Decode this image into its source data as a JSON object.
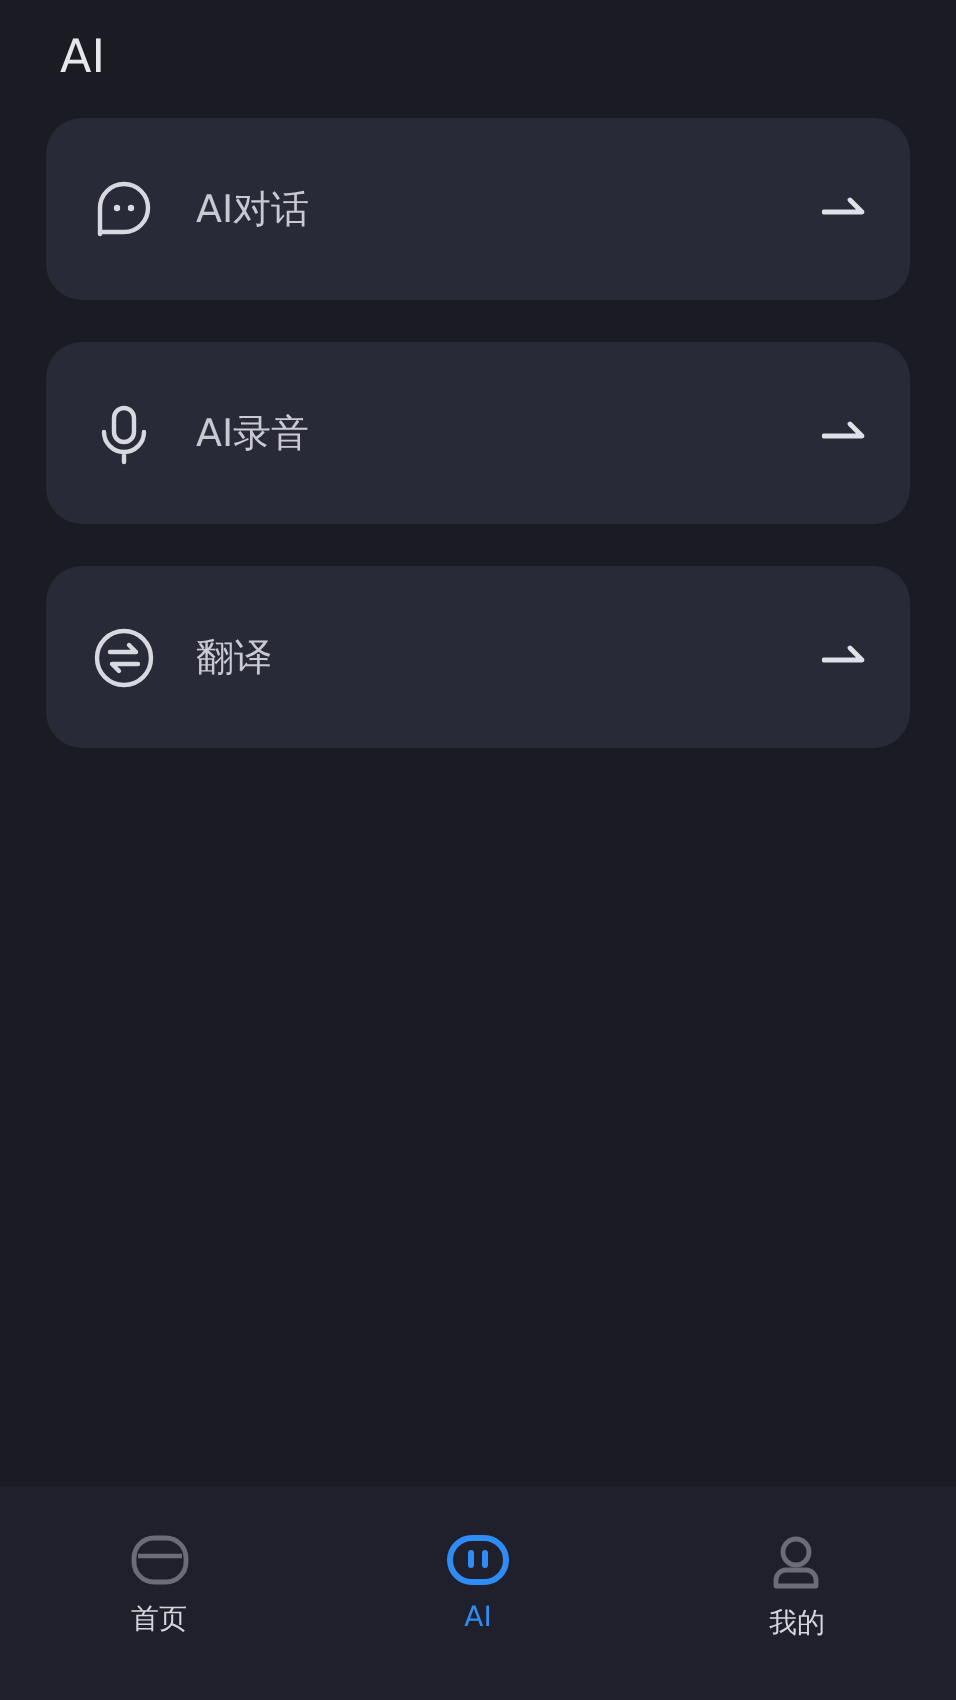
{
  "header": {
    "title": "AI"
  },
  "items": [
    {
      "kind": "chat",
      "label": "AI对话"
    },
    {
      "kind": "mic",
      "label": "AI录音"
    },
    {
      "kind": "translate",
      "label": "翻译"
    }
  ],
  "nav": [
    {
      "kind": "home",
      "label": "首页",
      "selected": false
    },
    {
      "kind": "ai",
      "label": "AI",
      "selected": true
    },
    {
      "kind": "profile",
      "label": "我的",
      "selected": false
    }
  ]
}
